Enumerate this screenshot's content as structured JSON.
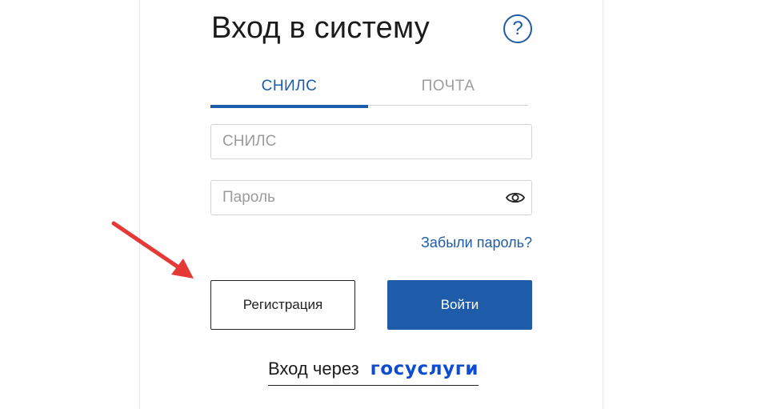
{
  "login": {
    "title": "Вход в систему",
    "help_icon": "question-circle-icon",
    "help_symbol": "?"
  },
  "tabs": [
    {
      "label": "СНИЛС",
      "active": true
    },
    {
      "label": "ПОЧТА",
      "active": false
    }
  ],
  "fields": {
    "snils": {
      "placeholder": "СНИЛС",
      "value": ""
    },
    "password": {
      "placeholder": "Пароль",
      "value": "",
      "toggle_icon": "eye-icon"
    }
  },
  "links": {
    "forgot_password": "Забыли пароль?"
  },
  "buttons": {
    "register": "Регистрация",
    "login": "Войти"
  },
  "gosuslugi": {
    "prefix": "Вход через",
    "brand": "госуслуги"
  },
  "colors": {
    "accent": "#1e5ba8",
    "brand_gosuslugi": "#0d4cd3",
    "annotation_arrow": "#e53935"
  }
}
